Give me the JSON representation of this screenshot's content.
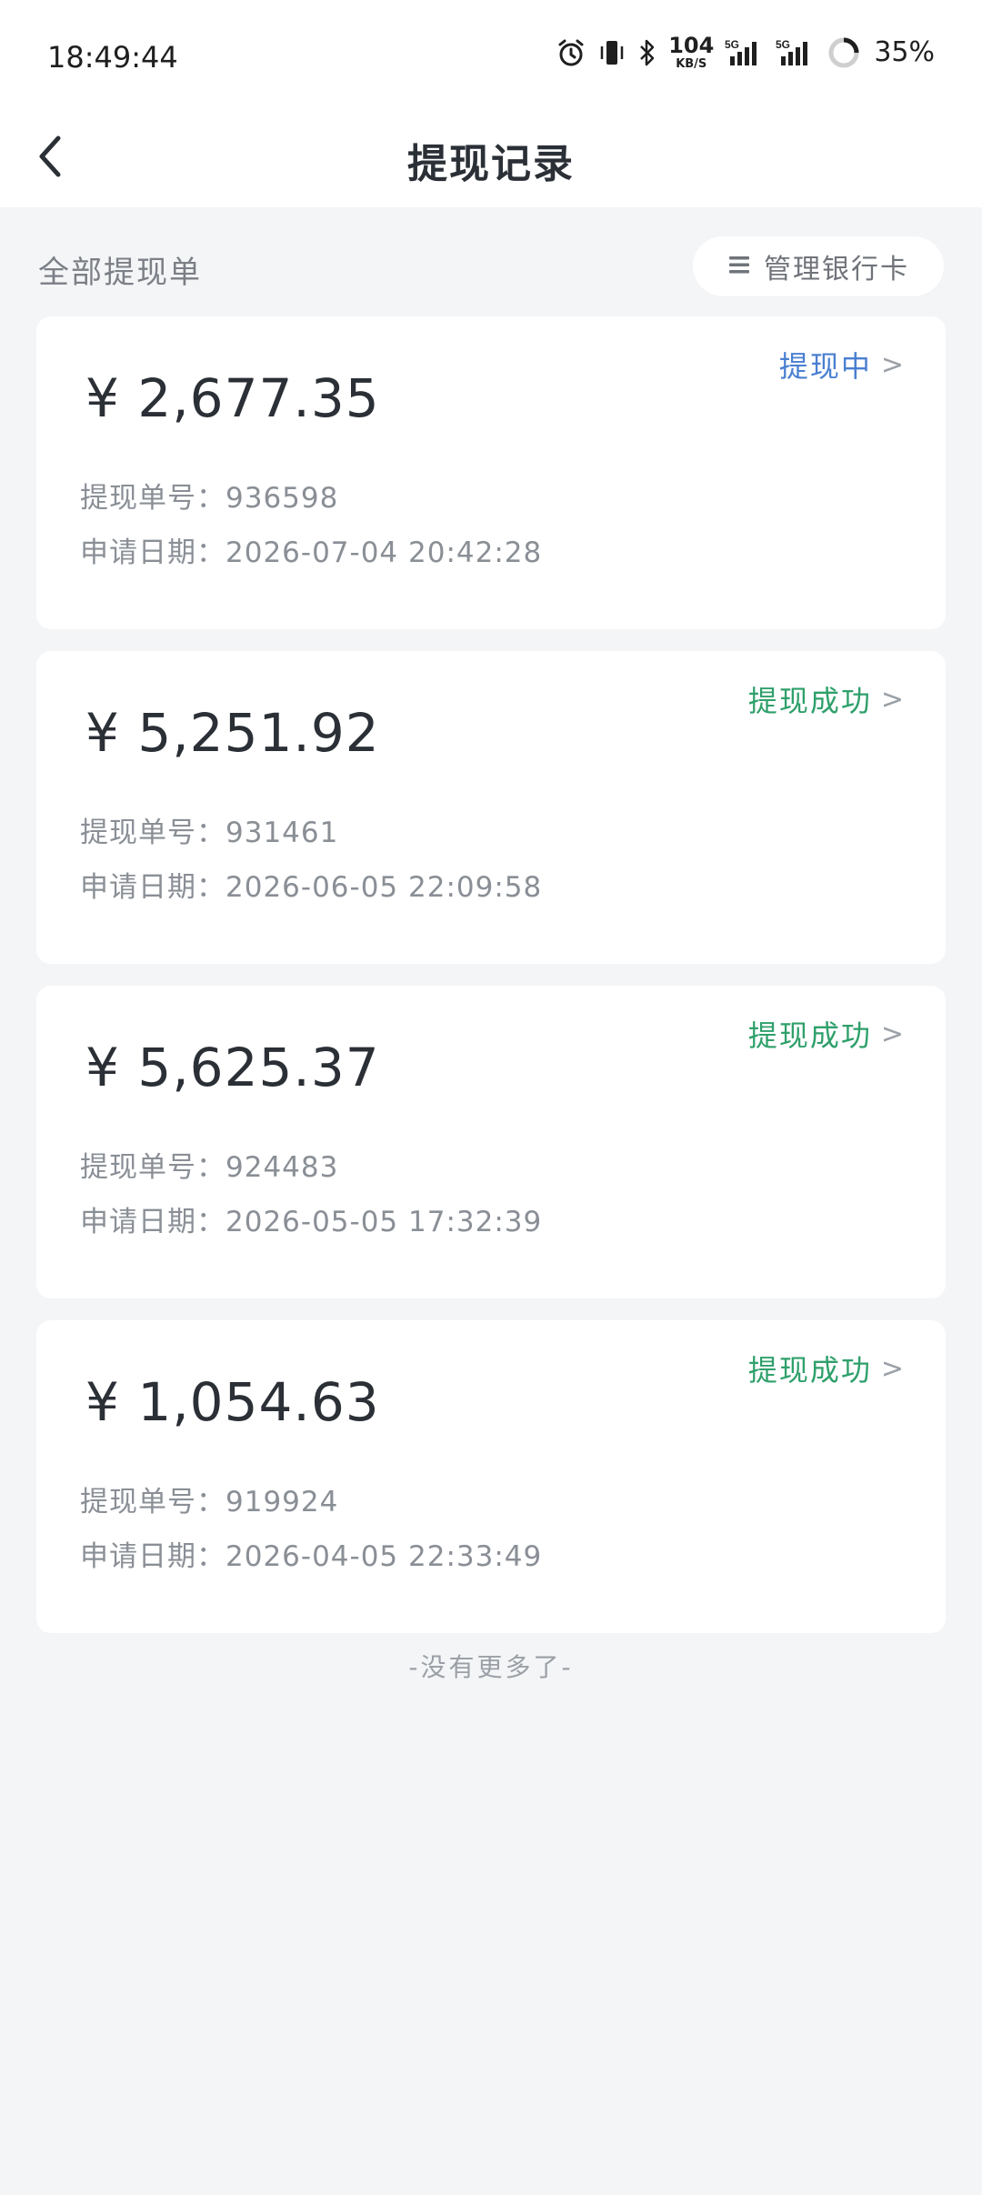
{
  "status_bar": {
    "time": "18:49:44",
    "net_speed_value": "104",
    "net_speed_unit": "KB/S",
    "sim1_label": "5G",
    "sim2_label": "5G",
    "battery": "35%"
  },
  "header": {
    "title": "提现记录",
    "back_icon": "chevron-left-icon"
  },
  "filter": {
    "title": "全部提现单",
    "manage_button_label": "管理银行卡",
    "manage_icon": "menu-icon"
  },
  "withdrawals": [
    {
      "amount": "¥ 2,677.35",
      "status": "提现中",
      "status_color": "#4a7fd1",
      "order_label": "提现单号：",
      "order_no": "936598",
      "date_label": "申请日期：",
      "date": "2026-07-04 20:42:28"
    },
    {
      "amount": "¥ 5,251.92",
      "status": "提现成功",
      "status_color": "#2fa06b",
      "order_label": "提现单号：",
      "order_no": "931461",
      "date_label": "申请日期：",
      "date": "2026-06-05 22:09:58"
    },
    {
      "amount": "¥ 5,625.37",
      "status": "提现成功",
      "status_color": "#2fa06b",
      "order_label": "提现单号：",
      "order_no": "924483",
      "date_label": "申请日期：",
      "date": "2026-05-05 17:32:39"
    },
    {
      "amount": "¥ 1,054.63",
      "status": "提现成功",
      "status_color": "#2fa06b",
      "order_label": "提现单号：",
      "order_no": "919924",
      "date_label": "申请日期：",
      "date": "2026-04-05 22:33:49"
    }
  ],
  "status_chevron": ">",
  "footer_note": "-没有更多了-"
}
